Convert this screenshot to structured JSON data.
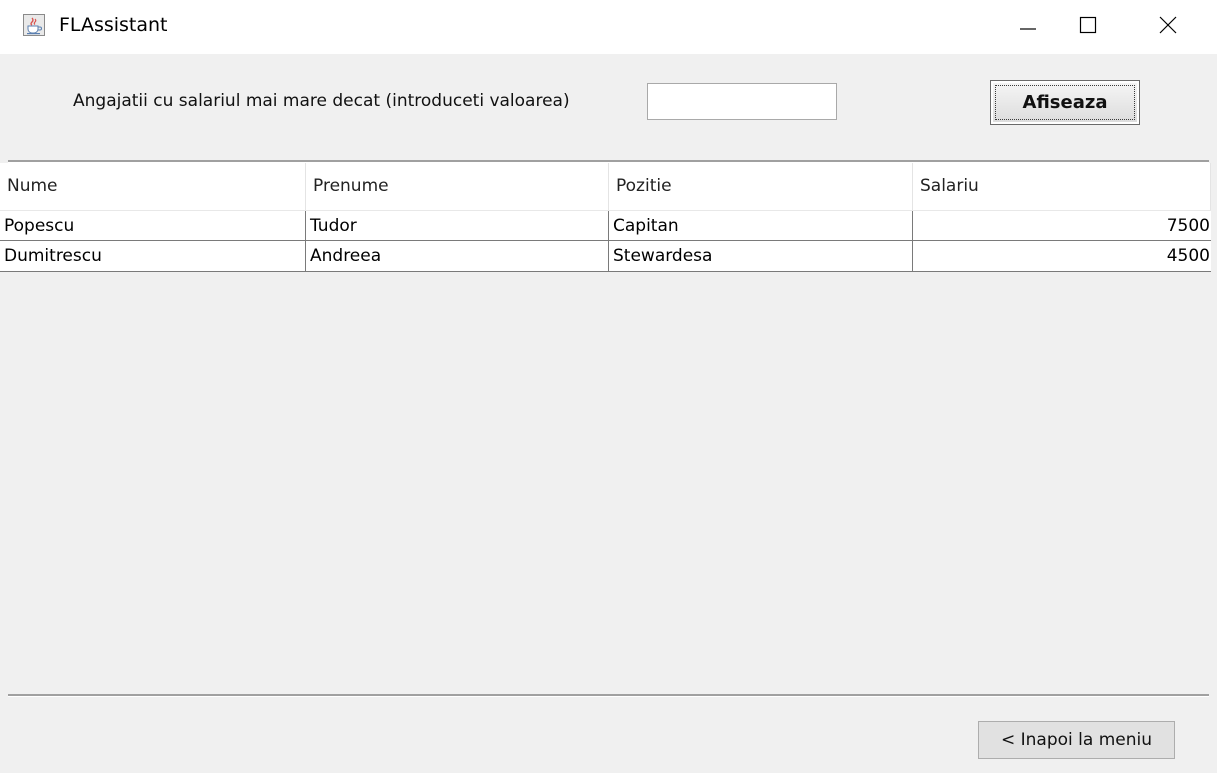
{
  "window": {
    "title": "FLAssistant",
    "icon": "java-cup-icon",
    "controls": [
      "minimize-icon",
      "maximize-icon",
      "close-icon"
    ]
  },
  "filter": {
    "label": "Angajatii cu salariul mai mare decat (introduceti valoarea)",
    "input_value": "",
    "button_label": "Afiseaza"
  },
  "table": {
    "columns": [
      "Nume",
      "Prenume",
      "Pozitie",
      "Salariu"
    ],
    "rows": [
      [
        "Popescu",
        "Tudor",
        "Capitan",
        "7500"
      ],
      [
        "Dumitrescu",
        "Andreea",
        "Stewardesa",
        "4500"
      ]
    ]
  },
  "footer": {
    "back_button_label": "< Inapoi la meniu"
  },
  "colors": {
    "window_bg": "#f0f0f0",
    "titlebar_bg": "#ffffff",
    "grid_line": "#7a7a7a"
  }
}
